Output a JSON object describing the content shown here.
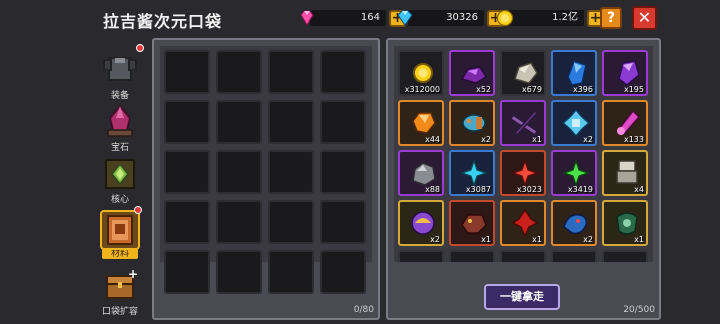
{
  "title": "拉吉酱次元口袋",
  "currencies": {
    "gems": "164",
    "diamonds": "30326",
    "coins": "1.2亿"
  },
  "buttons": {
    "help": "?",
    "close": "✕",
    "plus": "+",
    "take_all": "一键拿走"
  },
  "sidebar": {
    "items": [
      {
        "label": "装备",
        "icon": "armor-icon"
      },
      {
        "label": "宝石",
        "icon": "crystal-icon"
      },
      {
        "label": "核心",
        "icon": "core-icon"
      },
      {
        "label": "材料",
        "icon": "materials-icon"
      },
      {
        "label": "口袋扩容",
        "icon": "chest-expand-icon"
      }
    ]
  },
  "left_panel": {
    "capacity": "0/80"
  },
  "right_panel": {
    "capacity": "20/500",
    "items": [
      {
        "name": "gold-coin-icon",
        "qty": "x312000"
      },
      {
        "name": "purple-ore-icon",
        "qty": "x52"
      },
      {
        "name": "stone-icon",
        "qty": "x679"
      },
      {
        "name": "blue-crystal-icon",
        "qty": "x396"
      },
      {
        "name": "purple-crystal-icon",
        "qty": "x195"
      },
      {
        "name": "amber-gem-icon",
        "qty": "x44"
      },
      {
        "name": "fish-part-icon",
        "qty": "x2"
      },
      {
        "name": "crossbow-part-icon",
        "qty": "x1"
      },
      {
        "name": "ice-part-icon",
        "qty": "x2"
      },
      {
        "name": "pink-shard-icon",
        "qty": "x133"
      },
      {
        "name": "iron-ore-icon",
        "qty": "x88"
      },
      {
        "name": "cyan-star-icon",
        "qty": "x3087"
      },
      {
        "name": "red-star-icon",
        "qty": "x3023"
      },
      {
        "name": "green-star-icon",
        "qty": "x3419"
      },
      {
        "name": "gauntlet-icon",
        "qty": "x4"
      },
      {
        "name": "orb-icon",
        "qty": "x2"
      },
      {
        "name": "beast-head-icon",
        "qty": "x1"
      },
      {
        "name": "red-leaf-icon",
        "qty": "x1"
      },
      {
        "name": "dragon-icon",
        "qty": "x2"
      },
      {
        "name": "armor-plate-icon",
        "qty": "x1"
      }
    ]
  }
}
